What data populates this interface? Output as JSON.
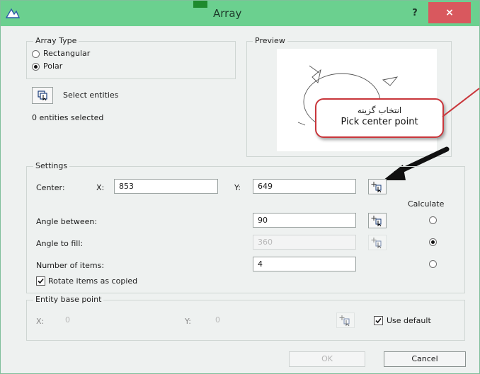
{
  "window": {
    "title": "Array",
    "help_label": "?",
    "close_label": "×"
  },
  "array_type": {
    "legend": "Array Type",
    "options": [
      {
        "label": "Rectangular",
        "selected": false
      },
      {
        "label": "Polar",
        "selected": true
      }
    ]
  },
  "selection": {
    "button_label": "Select entities",
    "status": "0 entities selected"
  },
  "preview": {
    "legend": "Preview"
  },
  "callout": {
    "persian": "انتخاب گزینه",
    "english": "Pick center point"
  },
  "settings": {
    "legend": "Settings",
    "center_label": "Center:",
    "x_label": "X:",
    "x_value": "853",
    "y_label": "Y:",
    "y_value": "649",
    "calculate_label": "Calculate",
    "angle_between_label": "Angle between:",
    "angle_between_value": "90",
    "angle_to_fill_label": "Angle to fill:",
    "angle_to_fill_value": "360",
    "number_of_items_label": "Number of items:",
    "number_of_items_value": "4",
    "rotate_label": "Rotate items as copied",
    "rotate_checked": true,
    "calculate_selected": "angle_to_fill"
  },
  "base_point": {
    "legend": "Entity base point",
    "x_label": "X:",
    "x_value": "0",
    "y_label": "Y:",
    "y_value": "0",
    "use_default_label": "Use default",
    "use_default_checked": true
  },
  "footer": {
    "ok_label": "OK",
    "cancel_label": "Cancel"
  },
  "colors": {
    "titlebar": "#6bd08f",
    "close": "#d9585e",
    "callout_border": "#c9363b"
  }
}
